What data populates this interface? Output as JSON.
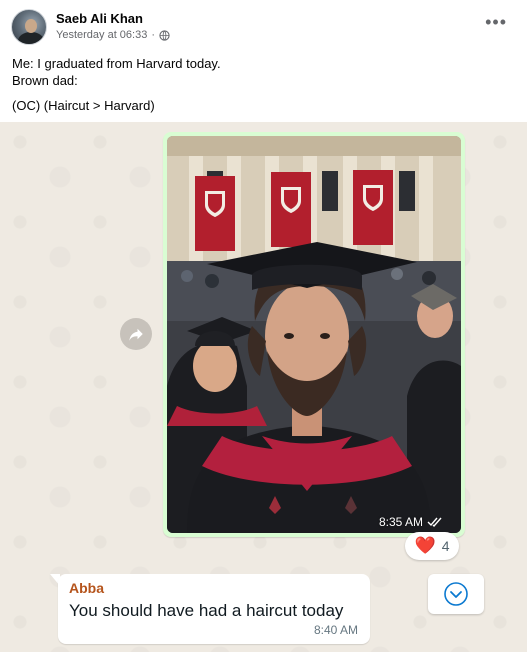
{
  "post": {
    "author": "Saeb Ali Khan",
    "timestamp": "Yesterday at 06:33",
    "privacy_icon": "globe-icon",
    "more_icon": "•••",
    "lines": [
      "Me: I graduated from Harvard today.",
      "Brown dad:",
      "(OC) (Haircut > Harvard)"
    ]
  },
  "chat": {
    "image_message": {
      "time": "8:35 AM",
      "status_icon": "double-check-icon",
      "reaction": {
        "emoji": "❤️",
        "count": "4"
      }
    },
    "text_message": {
      "sender": "Abba",
      "text": "You should have had a haircut today",
      "time": "8:40 AM"
    }
  },
  "colors": {
    "chat_background": "#efeae2",
    "outgoing_bubble": "#d9fdd3",
    "sender_name": "#b5541c",
    "scroll_icon": "#0b79d0"
  }
}
